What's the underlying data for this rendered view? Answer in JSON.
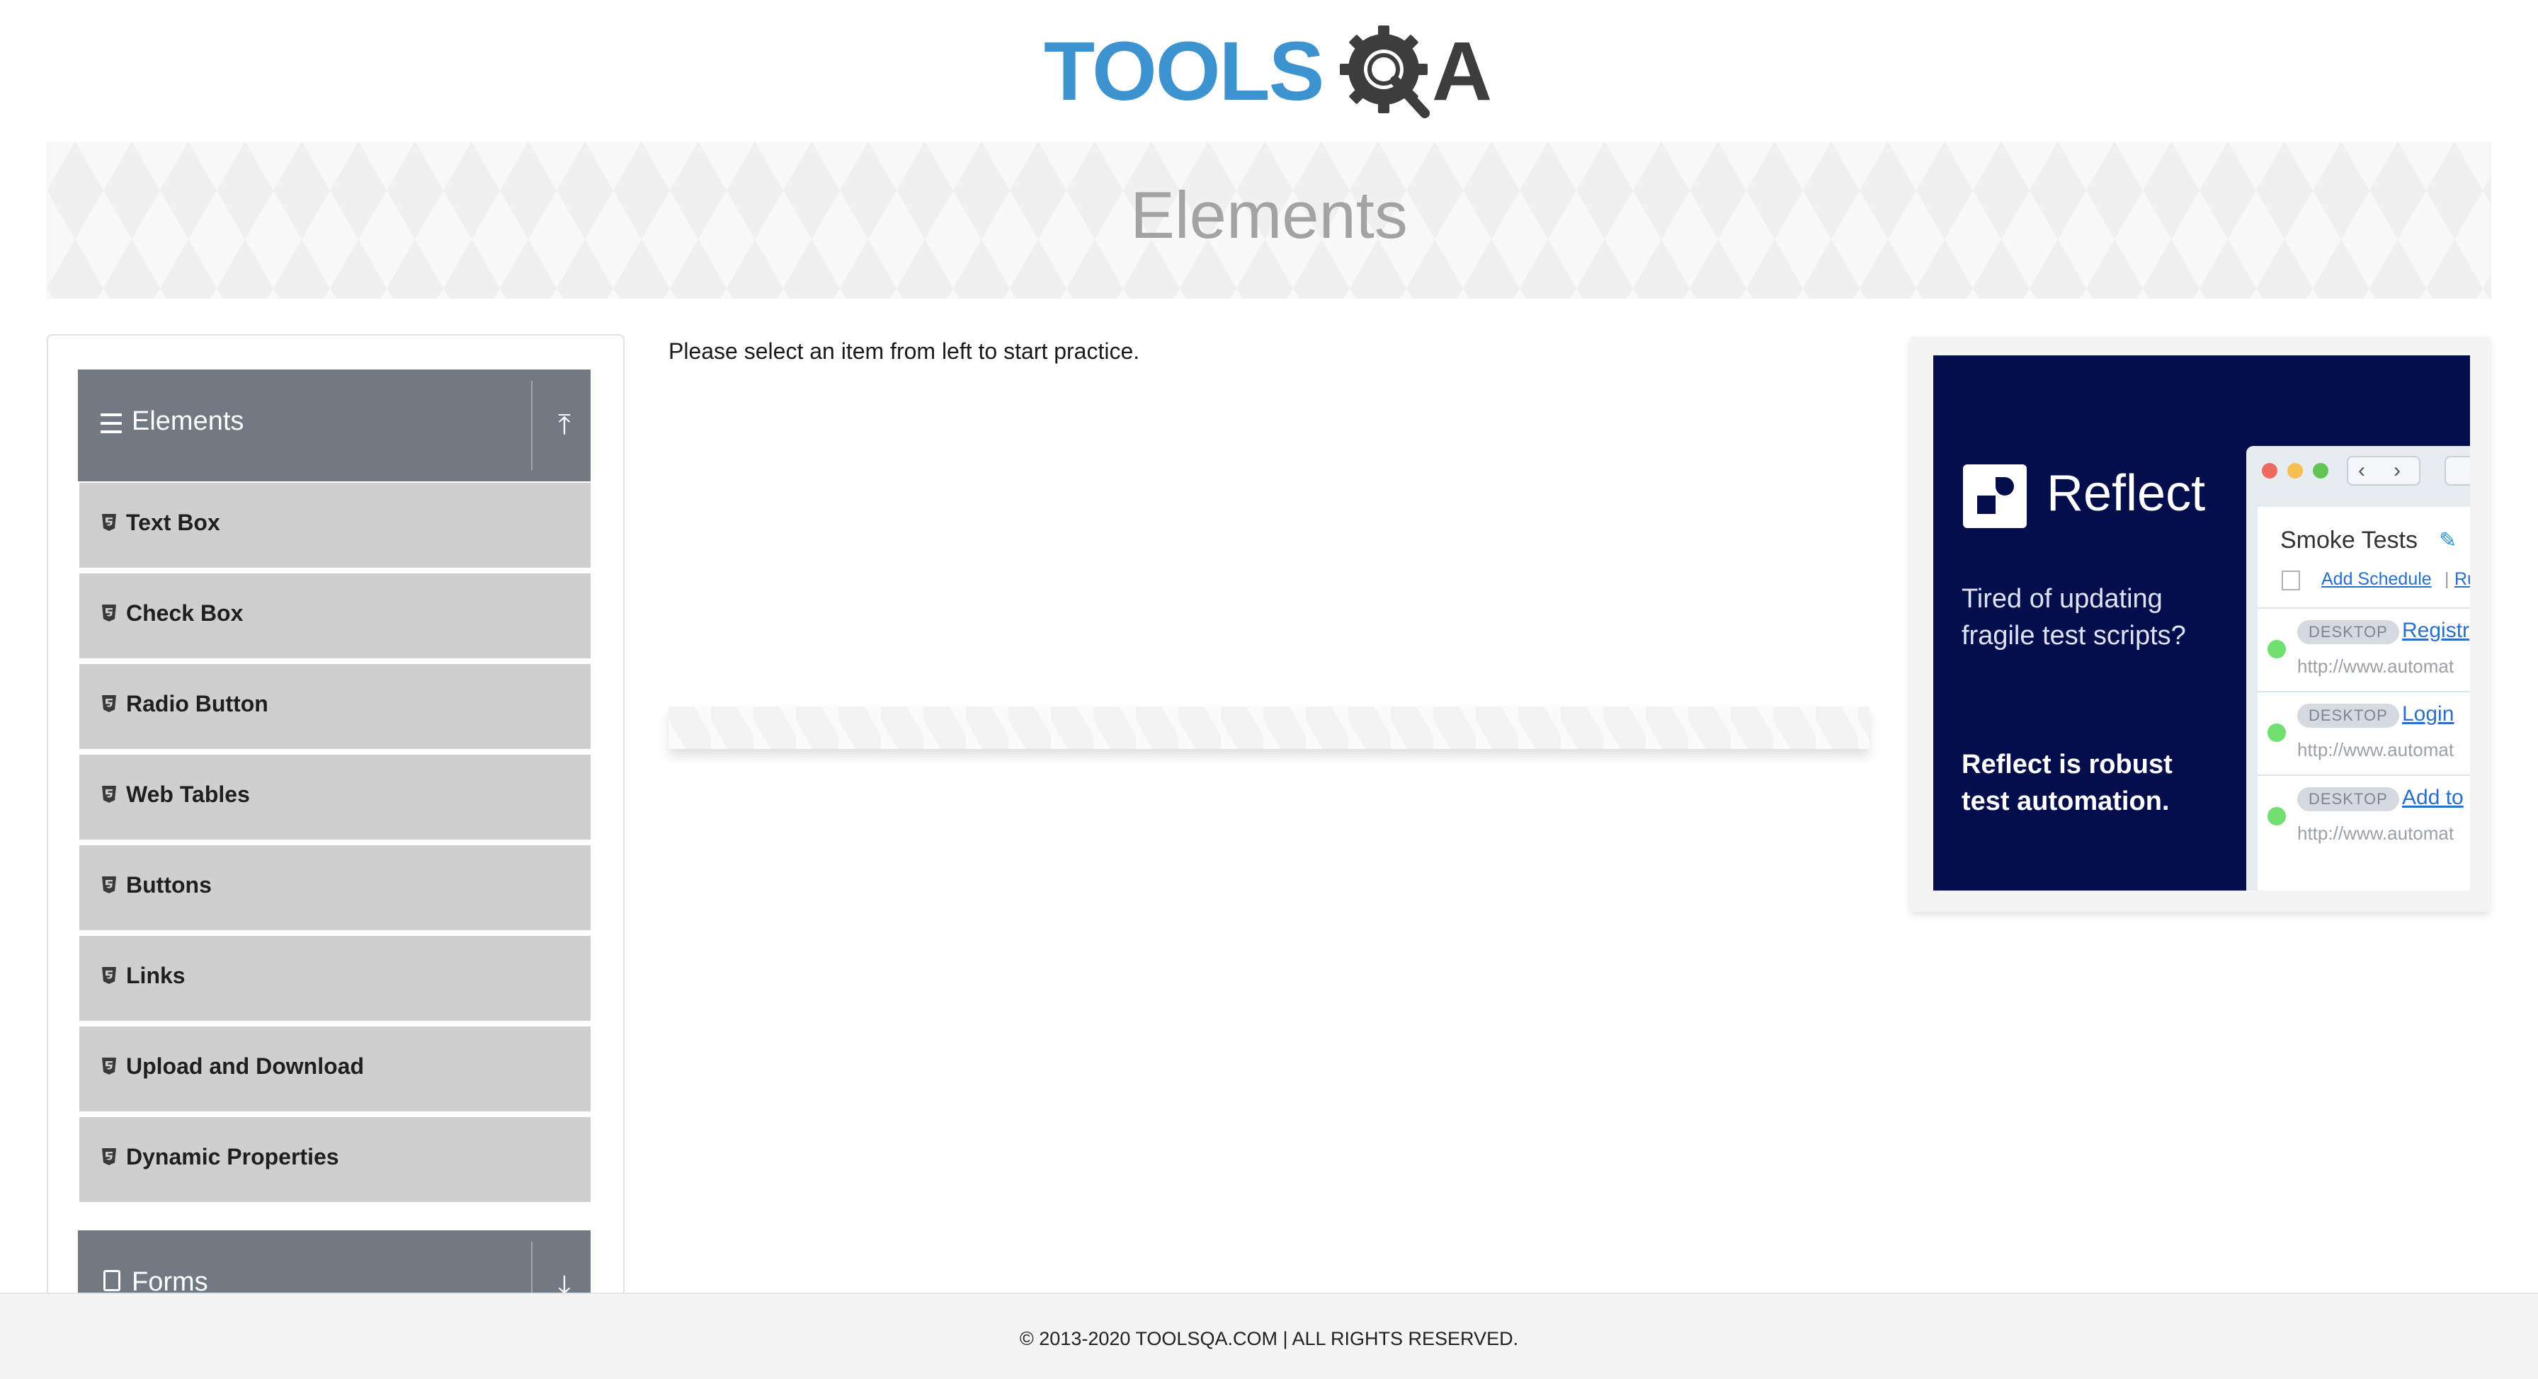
{
  "header": {
    "logo_text_main": "TOOLS",
    "logo_text_end": "A",
    "colors": {
      "logo_blue": "#3d93cf",
      "logo_dark": "#3d3d3d"
    }
  },
  "banner": {
    "title": "Elements"
  },
  "sidebar": {
    "groups": [
      {
        "title": "Elements",
        "icon": "hamburger-icon",
        "toggle_icon": "arrow-up-collapse-icon",
        "expanded": true,
        "items": [
          {
            "label": "Text Box",
            "icon": "html5-shield-icon"
          },
          {
            "label": "Check Box",
            "icon": "html5-shield-icon"
          },
          {
            "label": "Radio Button",
            "icon": "html5-shield-icon"
          },
          {
            "label": "Web Tables",
            "icon": "html5-shield-icon"
          },
          {
            "label": "Buttons",
            "icon": "html5-shield-icon"
          },
          {
            "label": "Links",
            "icon": "html5-shield-icon"
          },
          {
            "label": "Upload and Download",
            "icon": "html5-shield-icon"
          },
          {
            "label": "Dynamic Properties",
            "icon": "html5-shield-icon"
          }
        ]
      },
      {
        "title": "Forms",
        "icon": "document-icon",
        "toggle_icon": "arrow-down-expand-icon",
        "expanded": false
      }
    ],
    "colors": {
      "header_bg": "#717982",
      "item_bg": "#cfcfcf"
    }
  },
  "main": {
    "prompt": "Please select an item from left to start practice."
  },
  "ad": {
    "brand": "Reflect",
    "tagline": "Tired of updating fragile test scripts?",
    "tagline_bold": "Reflect is robust test automation.",
    "browser": {
      "suite_title": "Smoke Tests",
      "add_schedule": "Add Schedule",
      "separator": "|",
      "run_link": "Ru",
      "rows": [
        {
          "badge": "DESKTOP",
          "link": "Registr",
          "url": "http://www.automat"
        },
        {
          "badge": "DESKTOP",
          "link": "Login",
          "url": "http://www.automat"
        },
        {
          "badge": "DESKTOP",
          "link": "Add to",
          "url": "http://www.automat"
        }
      ]
    },
    "colors": {
      "bg": "#050e4c",
      "status_green": "#6fe06f",
      "link_blue": "#2a6fc9"
    }
  },
  "footer": {
    "text": "© 2013-2020 TOOLSQA.COM | ALL RIGHTS RESERVED."
  }
}
